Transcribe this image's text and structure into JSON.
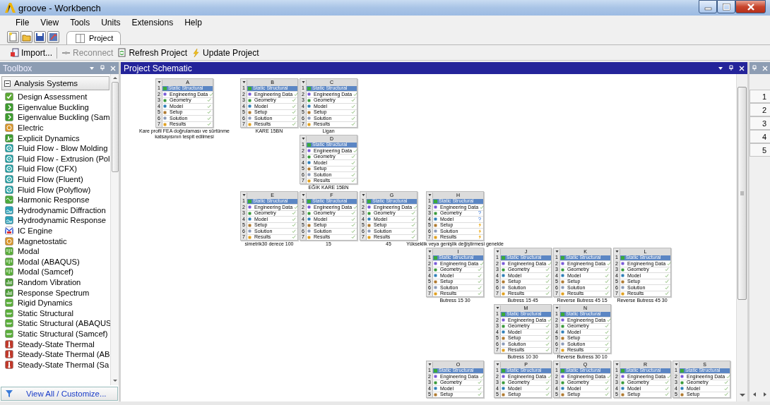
{
  "window": {
    "title": "groove - Workbench"
  },
  "menu": [
    "File",
    "View",
    "Tools",
    "Units",
    "Extensions",
    "Help"
  ],
  "tabs": [
    {
      "label": "Project",
      "selected": true
    }
  ],
  "toolbar": [
    {
      "label": "Import...",
      "disabled": false
    },
    {
      "label": "Reconnect",
      "disabled": true
    },
    {
      "label": "Refresh Project",
      "disabled": false
    },
    {
      "label": "Update Project",
      "disabled": false
    }
  ],
  "toolbox": {
    "title": "Toolbox",
    "group": {
      "label": "Analysis Systems",
      "expanded": true
    },
    "items": [
      "Design Assessment",
      "Eigenvalue Buckling",
      "Eigenvalue Buckling (Sam",
      "Electric",
      "Explicit Dynamics",
      "Fluid Flow - Blow Molding",
      "Fluid Flow - Extrusion (Pol",
      "Fluid Flow (CFX)",
      "Fluid Flow (Fluent)",
      "Fluid Flow (Polyflow)",
      "Harmonic Response",
      "Hydrodynamic Diffraction",
      "Hydrodynamic Response",
      "IC Engine",
      "Magnetostatic",
      "Modal",
      "Modal (ABAQUS)",
      "Modal (Samcef)",
      "Random Vibration",
      "Response Spectrum",
      "Rigid Dynamics",
      "Static Structural",
      "Static Structural (ABAQUS",
      "Static Structural (Samcef)",
      "Steady-State Thermal",
      "Steady-State Thermal (AB",
      "Steady-State Thermal (Sa"
    ],
    "footer": "View All / Customize..."
  },
  "schematic": {
    "title": "Project Schematic",
    "systems": [
      {
        "letter": "A",
        "title": "Static Structural",
        "caption": "Kare profil FEA doğrulaması ve sürtünme katsayısının tespit edilmesi",
        "rows": [
          {
            "n": "1"
          },
          {
            "n": "2",
            "label": "Engineering Data",
            "kind": "ok"
          },
          {
            "n": "3",
            "label": "Geometry",
            "kind": "ok"
          },
          {
            "n": "4",
            "label": "Model",
            "kind": "ok"
          },
          {
            "n": "5",
            "label": "Setup",
            "kind": "ok"
          },
          {
            "n": "6",
            "label": "Solution",
            "kind": "ok"
          },
          {
            "n": "7",
            "label": "Results",
            "kind": "ok"
          }
        ]
      },
      {
        "letter": "B",
        "title": "Static Structural",
        "caption": "KARE 15BN",
        "rows": [
          {
            "n": "1"
          },
          {
            "n": "2",
            "label": "Engineering Data",
            "kind": "ok"
          },
          {
            "n": "3",
            "label": "Geometry",
            "kind": "ok"
          },
          {
            "n": "4",
            "label": "Model",
            "kind": "ok"
          },
          {
            "n": "5",
            "label": "Setup",
            "kind": "ok"
          },
          {
            "n": "6",
            "label": "Solution",
            "kind": "ok"
          },
          {
            "n": "7",
            "label": "Results",
            "kind": "ok"
          }
        ]
      },
      {
        "letter": "C",
        "title": "Static Structural",
        "caption": "Ligan",
        "rows": [
          {
            "n": "1"
          },
          {
            "n": "2",
            "label": "Engineering Data",
            "kind": "ok"
          },
          {
            "n": "3",
            "label": "Geometry",
            "kind": "ok"
          },
          {
            "n": "4",
            "label": "Model",
            "kind": "ok"
          },
          {
            "n": "5",
            "label": "Setup",
            "kind": "ok"
          },
          {
            "n": "6",
            "label": "Solution",
            "kind": "ok"
          },
          {
            "n": "7",
            "label": "Results",
            "kind": "ok"
          }
        ]
      },
      {
        "letter": "D",
        "title": "Static Structural",
        "caption": "EĞİK KARE 15BN",
        "rows": [
          {
            "n": "1"
          },
          {
            "n": "2",
            "label": "Engineering Data",
            "kind": "ok"
          },
          {
            "n": "3",
            "label": "Geometry",
            "kind": "ok"
          },
          {
            "n": "4",
            "label": "Model",
            "kind": "ok"
          },
          {
            "n": "5",
            "label": "Setup",
            "kind": "ok"
          },
          {
            "n": "6",
            "label": "Solution",
            "kind": "ok"
          },
          {
            "n": "7",
            "label": "Results",
            "kind": "ok"
          }
        ]
      },
      {
        "letter": "E",
        "title": "Static Structural",
        "caption": "simetrik30 derece 100",
        "rows": [
          {
            "n": "1"
          },
          {
            "n": "2",
            "label": "Engineering Data",
            "kind": "ok"
          },
          {
            "n": "3",
            "label": "Geometry",
            "kind": "ok"
          },
          {
            "n": "4",
            "label": "Model",
            "kind": "ok"
          },
          {
            "n": "5",
            "label": "Setup",
            "kind": "ok"
          },
          {
            "n": "6",
            "label": "Solution",
            "kind": "ok"
          },
          {
            "n": "7",
            "label": "Results",
            "kind": "ok"
          }
        ]
      },
      {
        "letter": "F",
        "title": "Static Structural",
        "caption": "15",
        "rows": [
          {
            "n": "1"
          },
          {
            "n": "2",
            "label": "Engineering Data",
            "kind": "ok"
          },
          {
            "n": "3",
            "label": "Geometry",
            "kind": "ok"
          },
          {
            "n": "4",
            "label": "Model",
            "kind": "ok"
          },
          {
            "n": "5",
            "label": "Setup",
            "kind": "ok"
          },
          {
            "n": "6",
            "label": "Solution",
            "kind": "ok"
          },
          {
            "n": "7",
            "label": "Results",
            "kind": "ok"
          }
        ]
      },
      {
        "letter": "G",
        "title": "Static Structural",
        "caption": "45",
        "rows": [
          {
            "n": "1"
          },
          {
            "n": "2",
            "label": "Engineering Data",
            "kind": "ok"
          },
          {
            "n": "3",
            "label": "Geometry",
            "kind": "ok"
          },
          {
            "n": "4",
            "label": "Model",
            "kind": "ok"
          },
          {
            "n": "5",
            "label": "Setup",
            "kind": "ok"
          },
          {
            "n": "6",
            "label": "Solution",
            "kind": "ok"
          },
          {
            "n": "7",
            "label": "Results",
            "kind": "ok"
          }
        ]
      },
      {
        "letter": "H",
        "title": "Static Structural",
        "caption": "Yükseklik veya genişlik değiştirmesi genelde",
        "rows": [
          {
            "n": "1"
          },
          {
            "n": "2",
            "label": "Engineering Data",
            "kind": "ok"
          },
          {
            "n": "3",
            "label": "Geometry",
            "kind": "refresh"
          },
          {
            "n": "4",
            "label": "Model",
            "kind": "refresh"
          },
          {
            "n": "5",
            "label": "Setup",
            "kind": "update"
          },
          {
            "n": "6",
            "label": "Solution",
            "kind": "update"
          },
          {
            "n": "7",
            "label": "Results",
            "kind": "update"
          }
        ]
      },
      {
        "letter": "I",
        "title": "Static Structural",
        "caption": "Butress 15 30",
        "rows": [
          {
            "n": "1"
          },
          {
            "n": "2",
            "label": "Engineering Data",
            "kind": "ok"
          },
          {
            "n": "3",
            "label": "Geometry",
            "kind": "ok"
          },
          {
            "n": "4",
            "label": "Model",
            "kind": "ok"
          },
          {
            "n": "5",
            "label": "Setup",
            "kind": "ok"
          },
          {
            "n": "6",
            "label": "Solution",
            "kind": "ok"
          },
          {
            "n": "7",
            "label": "Results",
            "kind": "ok"
          }
        ]
      },
      {
        "letter": "J",
        "title": "Static Structural",
        "caption": "Butress 15 45",
        "rows": [
          {
            "n": "1"
          },
          {
            "n": "2",
            "label": "Engineering Data",
            "kind": "ok"
          },
          {
            "n": "3",
            "label": "Geometry",
            "kind": "ok"
          },
          {
            "n": "4",
            "label": "Model",
            "kind": "ok"
          },
          {
            "n": "5",
            "label": "Setup",
            "kind": "ok"
          },
          {
            "n": "6",
            "label": "Solution",
            "kind": "ok"
          },
          {
            "n": "7",
            "label": "Results",
            "kind": "ok"
          }
        ]
      },
      {
        "letter": "K",
        "title": "Static Structural",
        "caption": "Reverse Butress 45 15",
        "rows": [
          {
            "n": "1"
          },
          {
            "n": "2",
            "label": "Engineering Data",
            "kind": "ok"
          },
          {
            "n": "3",
            "label": "Geometry",
            "kind": "ok"
          },
          {
            "n": "4",
            "label": "Model",
            "kind": "ok"
          },
          {
            "n": "5",
            "label": "Setup",
            "kind": "ok"
          },
          {
            "n": "6",
            "label": "Solution",
            "kind": "ok"
          },
          {
            "n": "7",
            "label": "Results",
            "kind": "ok"
          }
        ]
      },
      {
        "letter": "L",
        "title": "Static Structural",
        "caption": "Reverse Butress 45 30",
        "rows": [
          {
            "n": "1"
          },
          {
            "n": "2",
            "label": "Engineering Data",
            "kind": "ok"
          },
          {
            "n": "3",
            "label": "Geometry",
            "kind": "ok"
          },
          {
            "n": "4",
            "label": "Model",
            "kind": "ok"
          },
          {
            "n": "5",
            "label": "Setup",
            "kind": "ok"
          },
          {
            "n": "6",
            "label": "Solution",
            "kind": "ok"
          },
          {
            "n": "7",
            "label": "Results",
            "kind": "ok"
          }
        ]
      },
      {
        "letter": "M",
        "title": "Static Structural",
        "caption": "Butress 10 30",
        "rows": [
          {
            "n": "1"
          },
          {
            "n": "2",
            "label": "Engineering Data",
            "kind": "ok"
          },
          {
            "n": "3",
            "label": "Geometry",
            "kind": "ok"
          },
          {
            "n": "4",
            "label": "Model",
            "kind": "ok"
          },
          {
            "n": "5",
            "label": "Setup",
            "kind": "ok"
          },
          {
            "n": "6",
            "label": "Solution",
            "kind": "ok"
          },
          {
            "n": "7",
            "label": "Results",
            "kind": "ok"
          }
        ]
      },
      {
        "letter": "N",
        "title": "Static Structural",
        "caption": "Reverse Butress 30 10",
        "rows": [
          {
            "n": "1"
          },
          {
            "n": "2",
            "label": "Engineering Data",
            "kind": "ok"
          },
          {
            "n": "3",
            "label": "Geometry",
            "kind": "ok"
          },
          {
            "n": "4",
            "label": "Model",
            "kind": "ok"
          },
          {
            "n": "5",
            "label": "Setup",
            "kind": "ok"
          },
          {
            "n": "6",
            "label": "Solution",
            "kind": "ok"
          },
          {
            "n": "7",
            "label": "Results",
            "kind": "ok"
          }
        ]
      },
      {
        "letter": "O",
        "title": "Static Structural",
        "rows": [
          {
            "n": "1"
          },
          {
            "n": "2",
            "label": "Engineering Data",
            "kind": "ok"
          },
          {
            "n": "3",
            "label": "Geometry",
            "kind": "ok"
          },
          {
            "n": "4",
            "label": "Model",
            "kind": "ok"
          },
          {
            "n": "5",
            "label": "Setup",
            "kind": "ok"
          }
        ]
      },
      {
        "letter": "P",
        "title": "Static Structural",
        "rows": [
          {
            "n": "1"
          },
          {
            "n": "2",
            "label": "Engineering Data",
            "kind": "ok"
          },
          {
            "n": "3",
            "label": "Geometry",
            "kind": "ok"
          },
          {
            "n": "4",
            "label": "Model",
            "kind": "ok"
          },
          {
            "n": "5",
            "label": "Setup",
            "kind": "ok"
          }
        ]
      },
      {
        "letter": "Q",
        "title": "Static Structural",
        "rows": [
          {
            "n": "1"
          },
          {
            "n": "2",
            "label": "Engineering Data",
            "kind": "ok"
          },
          {
            "n": "3",
            "label": "Geometry",
            "kind": "ok"
          },
          {
            "n": "4",
            "label": "Model",
            "kind": "ok"
          },
          {
            "n": "5",
            "label": "Setup",
            "kind": "ok"
          }
        ]
      },
      {
        "letter": "R",
        "title": "Static Structural",
        "rows": [
          {
            "n": "1"
          },
          {
            "n": "2",
            "label": "Engineering Data",
            "kind": "ok"
          },
          {
            "n": "3",
            "label": "Geometry",
            "kind": "ok"
          },
          {
            "n": "4",
            "label": "Model",
            "kind": "ok"
          },
          {
            "n": "5",
            "label": "Setup",
            "kind": "ok"
          }
        ]
      },
      {
        "letter": "S",
        "title": "Static Structural",
        "rows": [
          {
            "n": "1"
          },
          {
            "n": "2",
            "label": "Engineering Data",
            "kind": "ok"
          },
          {
            "n": "3",
            "label": "Geometry",
            "kind": "ok"
          },
          {
            "n": "4",
            "label": "Model",
            "kind": "ok"
          },
          {
            "n": "5",
            "label": "Setup",
            "kind": "ok"
          }
        ]
      }
    ]
  },
  "side_panel": {
    "tabs": [
      "1",
      "2",
      "3",
      "4",
      "5"
    ]
  }
}
